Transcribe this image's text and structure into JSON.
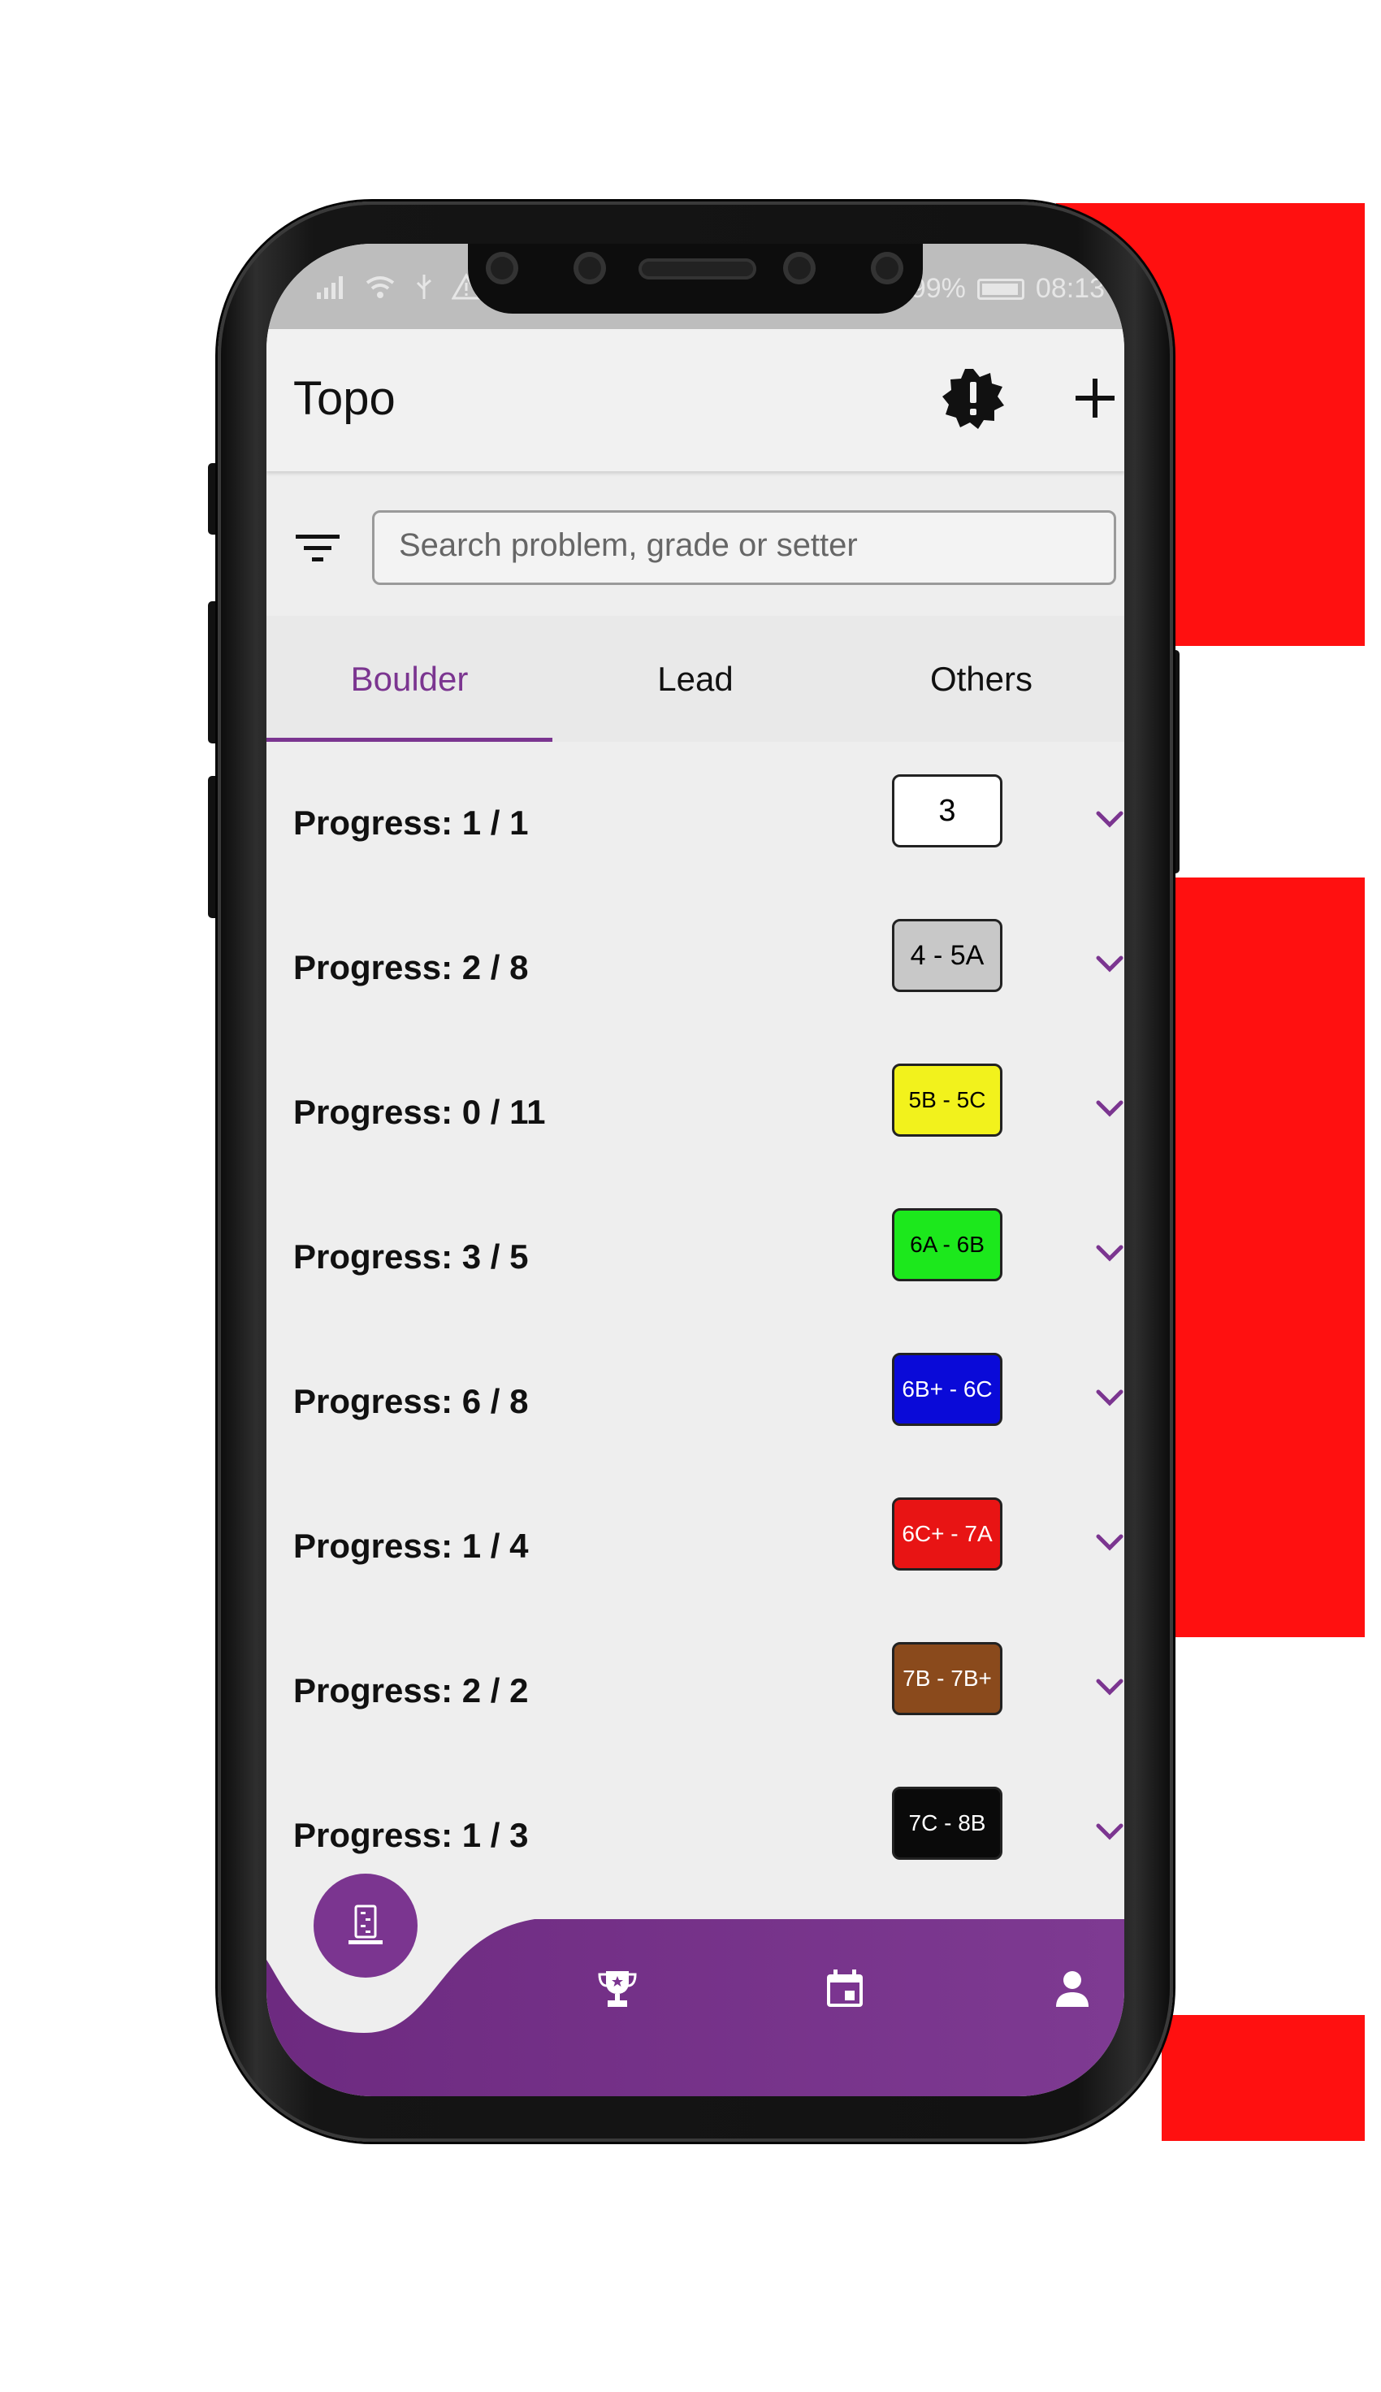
{
  "status_bar": {
    "battery": "99%",
    "time": "08:13"
  },
  "app_bar": {
    "title": "Topo"
  },
  "search": {
    "placeholder": "Search problem, grade or setter"
  },
  "tabs": [
    {
      "label": "Boulder",
      "active": true
    },
    {
      "label": "Lead",
      "active": false
    },
    {
      "label": "Others",
      "active": false
    }
  ],
  "rows": [
    {
      "progress": "Progress: 1 / 1",
      "grade": "3",
      "grade_bg": "#ffffff",
      "grade_fg": "#000000"
    },
    {
      "progress": "Progress: 2 / 8",
      "grade": "4 - 5A",
      "grade_bg": "#c8c8c8",
      "grade_fg": "#000000"
    },
    {
      "progress": "Progress: 0 / 11",
      "grade": "5B - 5C",
      "grade_bg": "#f2f21c",
      "grade_fg": "#000000"
    },
    {
      "progress": "Progress: 3 / 5",
      "grade": "6A - 6B",
      "grade_bg": "#1ce81c",
      "grade_fg": "#000000"
    },
    {
      "progress": "Progress: 6 / 8",
      "grade": "6B+ - 6C",
      "grade_bg": "#0a0ad8",
      "grade_fg": "#ffffff"
    },
    {
      "progress": "Progress: 1 / 4",
      "grade": "6C+ - 7A",
      "grade_bg": "#e81414",
      "grade_fg": "#ffffff"
    },
    {
      "progress": "Progress: 2 / 2",
      "grade": "7B - 7B+",
      "grade_bg": "#8a4a1c",
      "grade_fg": "#ffffff"
    },
    {
      "progress": "Progress: 1 / 3",
      "grade": "7C - 8B",
      "grade_bg": "#0a0a0a",
      "grade_fg": "#ffffff"
    }
  ],
  "bottom_nav": {
    "items": [
      "topo-icon",
      "trophy-icon",
      "calendar-icon",
      "person-icon"
    ],
    "active": "topo-icon"
  },
  "colors": {
    "accent": "#7b3590",
    "background_red": "#ff1010"
  }
}
